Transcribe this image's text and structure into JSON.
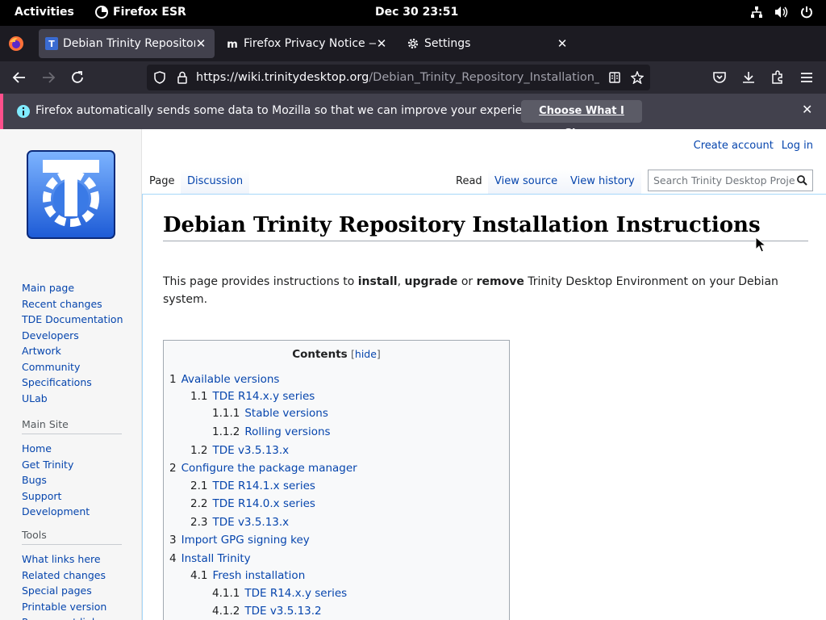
{
  "system": {
    "activities": "Activities",
    "app_name": "Firefox ESR",
    "clock": "Dec 30  23:51"
  },
  "tabs": [
    {
      "label": "Debian Trinity Repository",
      "active": true
    },
    {
      "label": "Firefox Privacy Notice — Mozilla",
      "active": false
    },
    {
      "label": "Settings",
      "active": false
    }
  ],
  "urlbar": {
    "host": "https://wiki.trinitydesktop.org",
    "path": "/Debian_Trinity_Repository_Installation_Instructions"
  },
  "notification": {
    "text": "Firefox automatically sends some data to Mozilla so that we can improve your experience.",
    "button": "Choose What I Share"
  },
  "personal": {
    "create_account": "Create account",
    "login": "Log in"
  },
  "views": {
    "page": "Page",
    "discussion": "Discussion",
    "read": "Read",
    "view_source": "View source",
    "view_history": "View history"
  },
  "search": {
    "placeholder": "Search Trinity Desktop Project"
  },
  "sidebar": {
    "navigation": [
      "Main page",
      "Recent changes",
      "TDE Documentation",
      "Developers",
      "Artwork",
      "Community",
      "Specifications",
      "ULab"
    ],
    "main_site_heading": "Main Site",
    "main_site": [
      "Home",
      "Get Trinity",
      "Bugs",
      "Support",
      "Development"
    ],
    "tools_heading": "Tools",
    "tools": [
      "What links here",
      "Related changes",
      "Special pages",
      "Printable version",
      "Permanent link"
    ]
  },
  "article": {
    "title": "Debian Trinity Repository Installation Instructions",
    "intro_1": "This page provides instructions to ",
    "intro_install": "install",
    "intro_2": ", ",
    "intro_upgrade": "upgrade",
    "intro_3": " or ",
    "intro_remove": "remove",
    "intro_4": " Trinity Desktop Environment on your Debian system."
  },
  "toc": {
    "heading": "Contents",
    "toggle": "hide",
    "items": [
      {
        "num": "1",
        "text": "Available versions",
        "level": 1
      },
      {
        "num": "1.1",
        "text": "TDE R14.x.y series",
        "level": 2
      },
      {
        "num": "1.1.1",
        "text": "Stable versions",
        "level": 3
      },
      {
        "num": "1.1.2",
        "text": "Rolling versions",
        "level": 3
      },
      {
        "num": "1.2",
        "text": "TDE v3.5.13.x",
        "level": 2
      },
      {
        "num": "2",
        "text": "Configure the package manager",
        "level": 1
      },
      {
        "num": "2.1",
        "text": "TDE R14.1.x series",
        "level": 2
      },
      {
        "num": "2.2",
        "text": "TDE R14.0.x series",
        "level": 2
      },
      {
        "num": "2.3",
        "text": "TDE v3.5.13.x",
        "level": 2
      },
      {
        "num": "3",
        "text": "Import GPG signing key",
        "level": 1
      },
      {
        "num": "4",
        "text": "Install Trinity",
        "level": 1
      },
      {
        "num": "4.1",
        "text": "Fresh installation",
        "level": 2
      },
      {
        "num": "4.1.1",
        "text": "TDE R14.x.y series",
        "level": 3
      },
      {
        "num": "4.1.2",
        "text": "TDE v3.5.13.2",
        "level": 3
      }
    ]
  }
}
